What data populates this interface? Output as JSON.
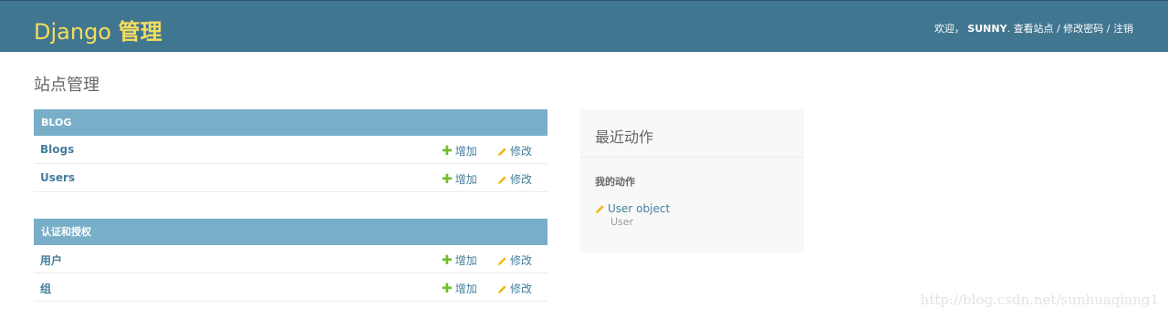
{
  "header": {
    "brand_latin": "Django",
    "brand_cn": "管理",
    "welcome": "欢迎，",
    "username": "SUNNY",
    "view_site": "查看站点",
    "change_password": "修改密码",
    "logout": "注销",
    "separator": "/",
    "period": "."
  },
  "page_title": "站点管理",
  "modules": [
    {
      "caption": "BLOG",
      "rows": [
        {
          "name": "Blogs",
          "add": "增加",
          "change": "修改"
        },
        {
          "name": "Users",
          "add": "增加",
          "change": "修改"
        }
      ]
    },
    {
      "caption": "认证和授权",
      "rows": [
        {
          "name": "用户",
          "add": "增加",
          "change": "修改"
        },
        {
          "name": "组",
          "add": "增加",
          "change": "修改"
        }
      ]
    }
  ],
  "recent_actions": {
    "title": "最近动作",
    "subtitle": "我的动作",
    "items": [
      {
        "label": "User object",
        "type": "User"
      }
    ]
  },
  "watermark": "http://blog.csdn.net/sunhuaqiang1",
  "colors": {
    "header_bg": "#417690",
    "brand": "#f5dd5d",
    "module_caption_bg": "#79aec8",
    "link": "#447e9b",
    "add_icon": "#70bf2b",
    "change_icon": "#efb80b"
  },
  "icons": {
    "add": "plus-icon",
    "change": "pencil-icon"
  }
}
